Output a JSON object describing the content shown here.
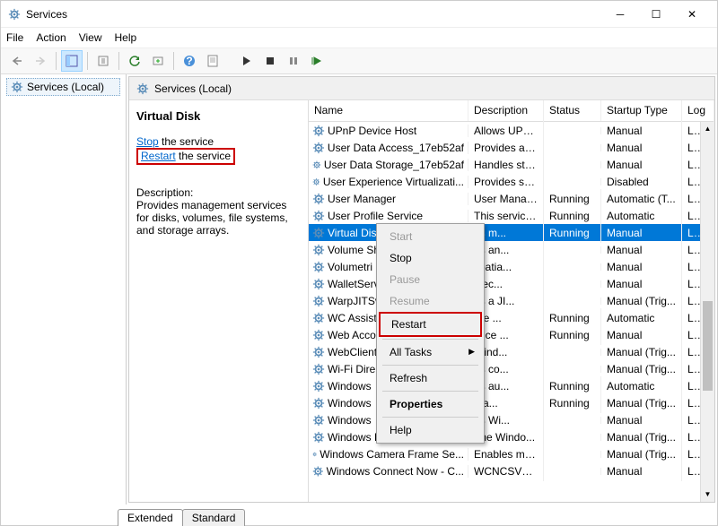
{
  "window": {
    "title": "Services"
  },
  "menu": {
    "file": "File",
    "action": "Action",
    "view": "View",
    "help": "Help"
  },
  "left": {
    "root": "Services (Local)"
  },
  "panel": {
    "header": "Services (Local)",
    "serviceName": "Virtual Disk",
    "stopLabel": "Stop",
    "stopSuffix": " the service",
    "restartLabel": "Restart",
    "restartSuffix": " the service",
    "descLabel": "Description:",
    "descText": "Provides management services for disks, volumes, file systems, and storage arrays."
  },
  "columns": {
    "name": "Name",
    "desc": "Description",
    "status": "Status",
    "startup": "Startup Type",
    "logon": "Log"
  },
  "rows": [
    {
      "name": "UPnP Device Host",
      "desc": "Allows UPn...",
      "status": "",
      "startup": "Manual",
      "log": "Loca"
    },
    {
      "name": "User Data Access_17eb52af",
      "desc": "Provides ap...",
      "status": "",
      "startup": "Manual",
      "log": "Loca"
    },
    {
      "name": "User Data Storage_17eb52af",
      "desc": "Handles sto...",
      "status": "",
      "startup": "Manual",
      "log": "Loca"
    },
    {
      "name": "User Experience Virtualizati...",
      "desc": "Provides su...",
      "status": "",
      "startup": "Disabled",
      "log": "Loca"
    },
    {
      "name": "User Manager",
      "desc": "User Manag...",
      "status": "Running",
      "startup": "Automatic (T...",
      "log": "Loca"
    },
    {
      "name": "User Profile Service",
      "desc": "This service ...",
      "status": "Running",
      "startup": "Automatic",
      "log": "Loca"
    },
    {
      "name": "Virtual Dis",
      "desc": "es m...",
      "status": "Running",
      "startup": "Manual",
      "log": "Loca",
      "selected": true
    },
    {
      "name": "Volume Sh",
      "desc": "es an...",
      "status": "",
      "startup": "Manual",
      "log": "Loca"
    },
    {
      "name": "Volumetri",
      "desc": "spatia...",
      "status": "",
      "startup": "Manual",
      "log": "Loca"
    },
    {
      "name": "WalletServ",
      "desc": "bjec...",
      "status": "",
      "startup": "Manual",
      "log": "Loca"
    },
    {
      "name": "WarpJITSv",
      "desc": "es a JI...",
      "status": "",
      "startup": "Manual (Trig...",
      "log": "Loca"
    },
    {
      "name": "WC Assist",
      "desc": "are ...",
      "status": "Running",
      "startup": "Automatic",
      "log": "Loca"
    },
    {
      "name": "Web Acco",
      "desc": "rvice ...",
      "status": "Running",
      "startup": "Manual",
      "log": "Loca"
    },
    {
      "name": "WebClient",
      "desc": "Wind...",
      "status": "",
      "startup": "Manual (Trig...",
      "log": "Loca"
    },
    {
      "name": "Wi-Fi Dire",
      "desc": "es co...",
      "status": "",
      "startup": "Manual (Trig...",
      "log": "Loca"
    },
    {
      "name": "Windows ",
      "desc": "es au...",
      "status": "Running",
      "startup": "Automatic",
      "log": "Loca"
    },
    {
      "name": "Windows ",
      "desc": "ma...",
      "status": "Running",
      "startup": "Manual (Trig...",
      "log": "Loca"
    },
    {
      "name": "Windows ",
      "desc": "es Wi...",
      "status": "",
      "startup": "Manual",
      "log": "Loca"
    },
    {
      "name": "Windows Biometric Service",
      "desc": "The Windo...",
      "status": "",
      "startup": "Manual (Trig...",
      "log": "Loca"
    },
    {
      "name": "Windows Camera Frame Se...",
      "desc": "Enables mul...",
      "status": "",
      "startup": "Manual (Trig...",
      "log": "Loca"
    },
    {
      "name": "Windows Connect Now - C...",
      "desc": "WCNCSVC ...",
      "status": "",
      "startup": "Manual",
      "log": "Loca"
    }
  ],
  "tabs": {
    "extended": "Extended",
    "standard": "Standard"
  },
  "ctx": {
    "start": "Start",
    "stop": "Stop",
    "pause": "Pause",
    "resume": "Resume",
    "restart": "Restart",
    "alltasks": "All Tasks",
    "refresh": "Refresh",
    "properties": "Properties",
    "help": "Help"
  }
}
